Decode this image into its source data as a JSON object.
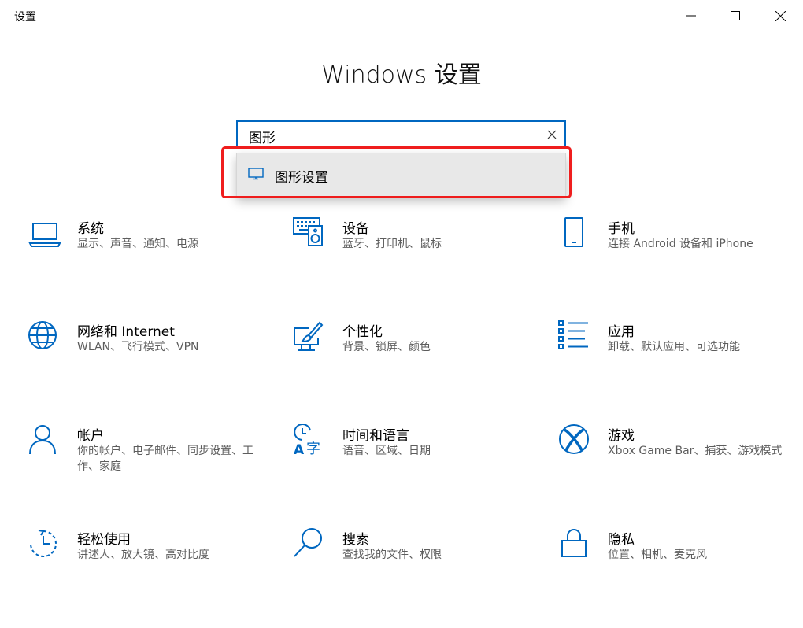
{
  "window": {
    "title": "设置"
  },
  "heading": "Windows 设置",
  "search": {
    "value": "图形"
  },
  "suggestion": {
    "label": "图形设置"
  },
  "colors": {
    "accent": "#0067c0",
    "highlight_border": "#ef1d1d",
    "dropdown_bg": "#e8e8e8"
  },
  "tiles": [
    {
      "icon": "laptop-icon",
      "title": "系统",
      "desc": "显示、声音、通知、电源"
    },
    {
      "icon": "keyboard-speaker-icon",
      "title": "设备",
      "desc": "蓝牙、打印机、鼠标"
    },
    {
      "icon": "phone-icon",
      "title": "手机",
      "desc": "连接 Android 设备和 iPhone"
    },
    {
      "icon": "globe-icon",
      "title": "网络和 Internet",
      "desc": "WLAN、飞行模式、VPN"
    },
    {
      "icon": "paint-brush-icon",
      "title": "个性化",
      "desc": "背景、锁屏、颜色"
    },
    {
      "icon": "apps-list-icon",
      "title": "应用",
      "desc": "卸载、默认应用、可选功能"
    },
    {
      "icon": "person-icon",
      "title": "帐户",
      "desc": "你的帐户、电子邮件、同步设置、工作、家庭"
    },
    {
      "icon": "time-language-icon",
      "title": "时间和语言",
      "desc": "语音、区域、日期"
    },
    {
      "icon": "xbox-icon",
      "title": "游戏",
      "desc": "Xbox Game Bar、捕获、游戏模式"
    },
    {
      "icon": "ease-of-access-icon",
      "title": "轻松使用",
      "desc": "讲述人、放大镜、高对比度"
    },
    {
      "icon": "search-icon",
      "title": "搜索",
      "desc": "查找我的文件、权限"
    },
    {
      "icon": "lock-icon",
      "title": "隐私",
      "desc": "位置、相机、麦克风"
    }
  ]
}
